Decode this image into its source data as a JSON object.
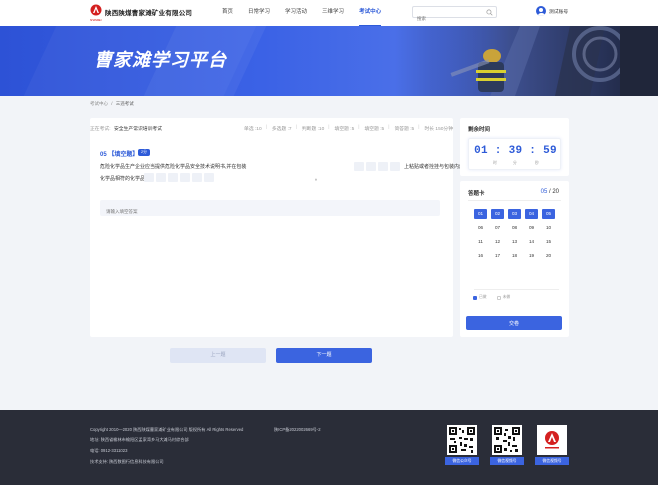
{
  "header": {
    "company": "陕西陕煤曹家滩矿业有限公司",
    "logo_sub": "SHANMEI",
    "nav": [
      "首页",
      "日常学习",
      "学习活动",
      "三维学习",
      "考试中心"
    ],
    "active_nav_index": 4,
    "search_placeholder": "搜索",
    "user_name": "测试账号"
  },
  "banner": {
    "title": "曹家滩学习平台"
  },
  "breadcrumb": {
    "root": "考试中心",
    "separator": "/",
    "current": "三违考试"
  },
  "exam": {
    "label": "正在考试:",
    "name": "安全生产常识培训考试",
    "stats": [
      "单选 :10",
      "多选题 :7",
      "判断题 :10",
      "填空题 :5",
      "填空题 :5",
      "简答题 :5",
      "时长 150分钟"
    ]
  },
  "question": {
    "number": "05 【填空题】",
    "badge": "2分",
    "line1": "危险化学品生产企业应当提供危险化学品安全技术说明书,并在包装",
    "line1_tail": "上粘贴或者拴挂与包装内危险",
    "line2": "化学品相符的化学品",
    "line2_end": "。",
    "answer_placeholder": "请输入填空答案"
  },
  "buttons": {
    "prev": "上一题",
    "next": "下一题",
    "submit": "交卷"
  },
  "timer": {
    "title": "剩余时间",
    "value": "01 : 39 : 59",
    "units": [
      "时",
      "分",
      "秒"
    ]
  },
  "sheet": {
    "title": "答题卡",
    "current": "05",
    "total": "/ 20",
    "cells": [
      "01",
      "02",
      "03",
      "04",
      "05",
      "06",
      "07",
      "08",
      "09",
      "10",
      "11",
      "12",
      "13",
      "14",
      "15",
      "16",
      "17",
      "18",
      "19",
      "20"
    ],
    "done_count": 5,
    "legend_done": "已做",
    "legend_todo": "未做"
  },
  "footer": {
    "copyright": "Copyright 2010—2020 陕西陕煤曹家滩矿业有限公司 版权所有 All Rights Reserved",
    "icp": "陕ICP备2022002669号-2",
    "address": "地址:  陕西省榆林市榆阳区孟家湾乡马大滩马村综合部",
    "phone": "电话:  0912-3311023",
    "support": "技术支持:  陕西数图行信息科技有限公司",
    "qr_labels": [
      "微信公众号",
      "微信视频号",
      "微信视频号"
    ]
  },
  "colors": {
    "accent": "#2e5bd8",
    "footer_bg": "#2a2d38",
    "page_bg": "#f2f4f8"
  }
}
